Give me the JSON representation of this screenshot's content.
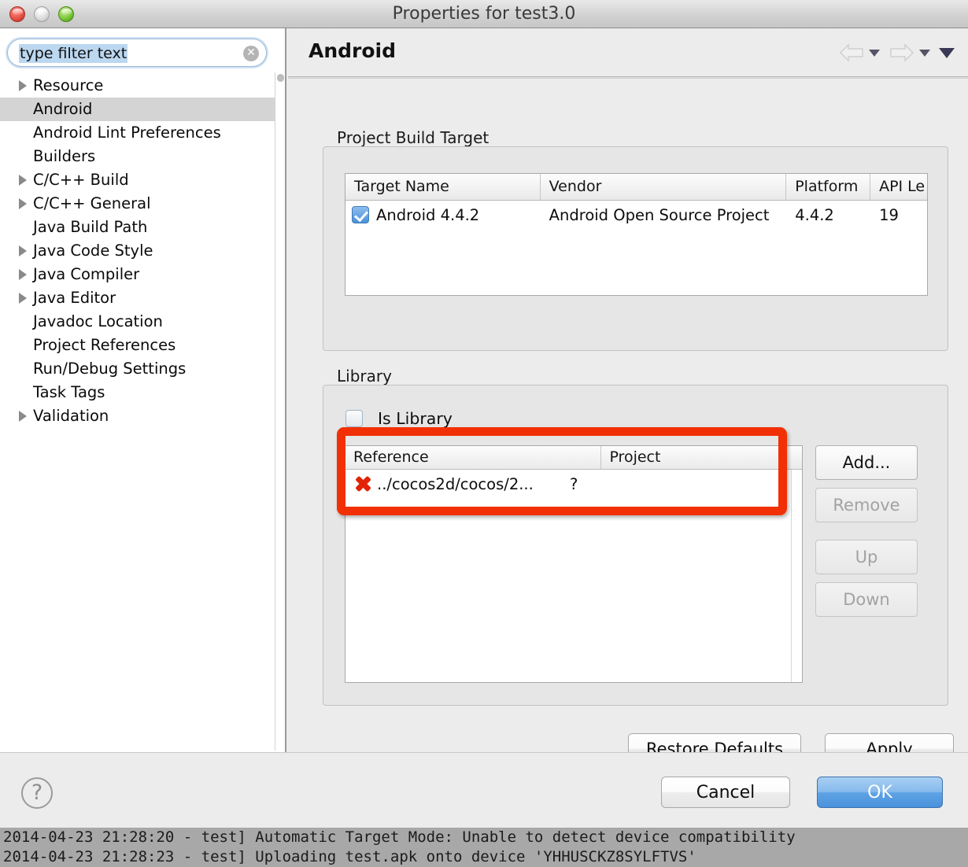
{
  "window": {
    "title": "Properties for test3.0",
    "controls": {
      "close": "close-button",
      "minimize": "minimize-button",
      "zoom": "zoom-button"
    }
  },
  "sidebar": {
    "filter": {
      "value": "type filter text",
      "placeholder": "type filter text",
      "clear_label": "✕"
    },
    "items": [
      {
        "label": "Resource",
        "expandable": true,
        "selected": false
      },
      {
        "label": "Android",
        "expandable": false,
        "selected": true
      },
      {
        "label": "Android Lint Preferences",
        "expandable": false,
        "selected": false
      },
      {
        "label": "Builders",
        "expandable": false,
        "selected": false
      },
      {
        "label": "C/C++ Build",
        "expandable": true,
        "selected": false
      },
      {
        "label": "C/C++ General",
        "expandable": true,
        "selected": false
      },
      {
        "label": "Java Build Path",
        "expandable": false,
        "selected": false
      },
      {
        "label": "Java Code Style",
        "expandable": true,
        "selected": false
      },
      {
        "label": "Java Compiler",
        "expandable": true,
        "selected": false
      },
      {
        "label": "Java Editor",
        "expandable": true,
        "selected": false
      },
      {
        "label": "Javadoc Location",
        "expandable": false,
        "selected": false
      },
      {
        "label": "Project References",
        "expandable": false,
        "selected": false
      },
      {
        "label": "Run/Debug Settings",
        "expandable": false,
        "selected": false
      },
      {
        "label": "Task Tags",
        "expandable": false,
        "selected": false
      },
      {
        "label": "Validation",
        "expandable": true,
        "selected": false
      }
    ]
  },
  "page": {
    "title": "Android",
    "build_target": {
      "group_label": "Project Build Target",
      "columns": [
        "Target Name",
        "Vendor",
        "Platform",
        "API Le"
      ],
      "rows": [
        {
          "checked": true,
          "target_name": "Android 4.4.2",
          "vendor": "Android Open Source Project",
          "platform": "4.4.2",
          "api_level": "19"
        }
      ]
    },
    "library": {
      "group_label": "Library",
      "is_library_label": "Is Library",
      "is_library_checked": false,
      "columns": [
        "Reference",
        "Project"
      ],
      "rows": [
        {
          "status": "error",
          "reference": "../cocos2d/cocos/2...",
          "project": "?"
        }
      ],
      "buttons": [
        {
          "label": "Add...",
          "enabled": true
        },
        {
          "label": "Remove",
          "enabled": false
        },
        {
          "label": "Up",
          "enabled": false
        },
        {
          "label": "Down",
          "enabled": false
        }
      ]
    },
    "actions": {
      "restore_defaults": "Restore Defaults",
      "apply": "Apply"
    }
  },
  "footer": {
    "help_label": "?",
    "cancel": "Cancel",
    "ok": "OK"
  },
  "console": {
    "lines": [
      "2014-04-23 21:28:20 - test] Automatic Target Mode: Unable to detect device compatibility",
      "2014-04-23 21:28:23 - test] Uploading test.apk onto device 'YHHUSCKZ8SYLFTVS'"
    ]
  },
  "colors": {
    "accent": "#4a92dd",
    "annotation": "#f23005",
    "error": "#e12408",
    "selection": "#d4d4d4"
  }
}
